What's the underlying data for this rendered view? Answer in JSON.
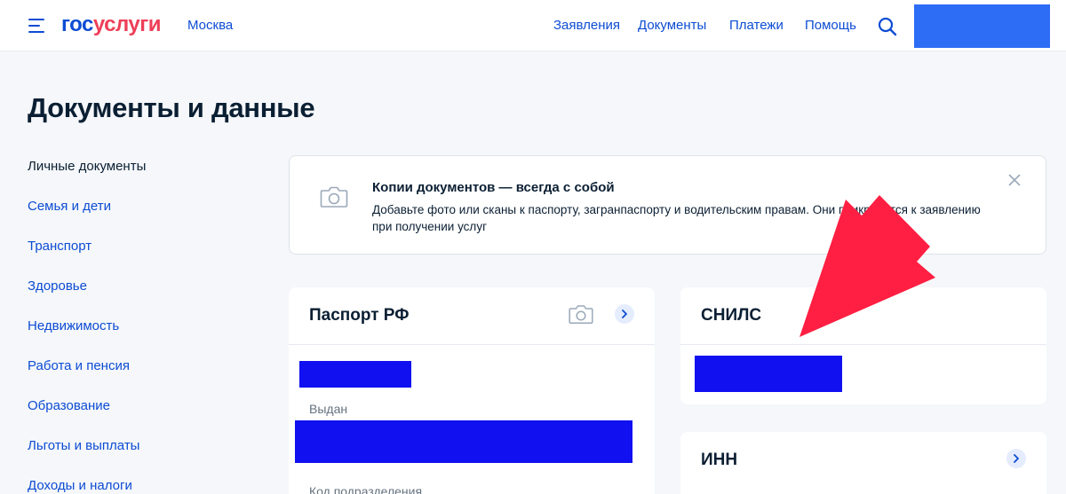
{
  "header": {
    "logo_part1": "гос",
    "logo_part2": "услуги",
    "city": "Москва",
    "nav": [
      "Заявления",
      "Документы",
      "Платежи",
      "Помощь"
    ]
  },
  "page": {
    "title": "Документы и данные"
  },
  "sidebar": {
    "items": [
      "Личные документы",
      "Семья и дети",
      "Транспорт",
      "Здоровье",
      "Недвижимость",
      "Работа и пенсия",
      "Образование",
      "Льготы и выплаты",
      "Доходы и налоги"
    ],
    "active_index": 0
  },
  "banner": {
    "icon": "camera-icon",
    "title": "Копии документов — всегда с собой",
    "text": "Добавьте фото или сканы к паспорту, загранпаспорту и водительским правам. Они прикрепятся к заявлению при получении услуг"
  },
  "cards": {
    "passport": {
      "title": "Паспорт РФ",
      "issued_label": "Выдан",
      "code_label": "Код подразделения"
    },
    "snils": {
      "title": "СНИЛС"
    },
    "inn": {
      "title": "ИНН"
    }
  },
  "colors": {
    "brand_blue": "#0d4cd3",
    "brand_red": "#ee3f58",
    "redaction": "#1010f0",
    "arrow": "#fe1f42"
  }
}
